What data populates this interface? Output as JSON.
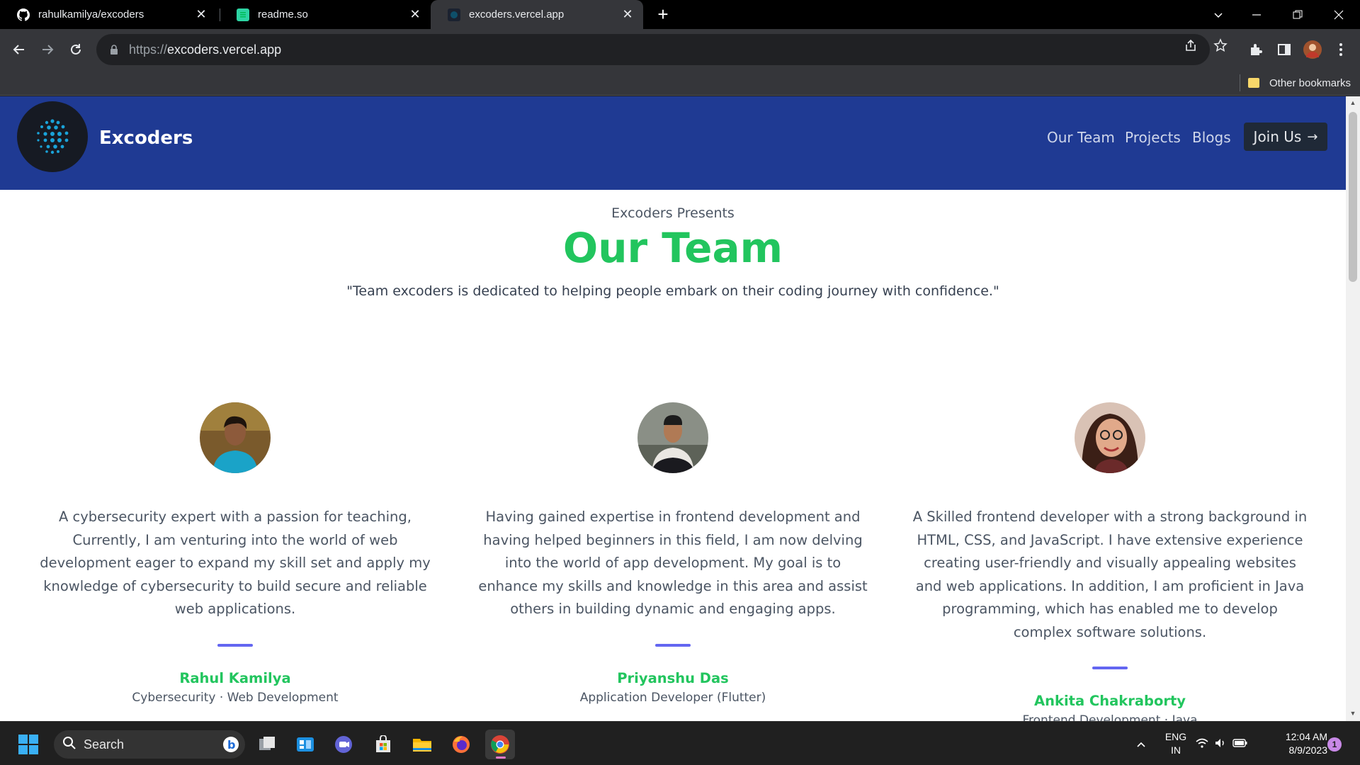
{
  "browser": {
    "tabs": [
      {
        "title": "rahulkamilya/excoders",
        "icon": "github-icon"
      },
      {
        "title": "readme.so",
        "icon": "readme-icon"
      },
      {
        "title": "excoders.vercel.app",
        "icon": "site-icon"
      }
    ],
    "url_scheme": "https://",
    "url_host": "excoders.vercel.app",
    "bookmarks": {
      "other_label": "Other bookmarks"
    }
  },
  "site": {
    "brand": "Excoders",
    "nav": {
      "our_team": "Our Team",
      "projects": "Projects",
      "blogs": "Blogs",
      "join": "Join Us"
    },
    "presents": "Excoders Presents",
    "title": "Our Team",
    "quote": "\"Team excoders is dedicated to helping people embark on their coding journey with confidence.\"",
    "members": [
      {
        "bio": "A cybersecurity expert with a passion for teaching, Currently, I am venturing into the world of web development eager to expand my skill set and apply my knowledge of cybersecurity to build secure and reliable web applications.",
        "name": "Rahul Kamilya",
        "role": "Cybersecurity · Web Development"
      },
      {
        "bio": "Having gained expertise in frontend development and having helped beginners in this field, I am now delving into the world of app development. My goal is to enhance my skills and knowledge in this area and assist others in building dynamic and engaging apps.",
        "name": "Priyanshu Das",
        "role": "Application Developer (Flutter)"
      },
      {
        "bio": "A Skilled frontend developer with a strong background in HTML, CSS, and JavaScript. I have extensive experience creating user-friendly and visually appealing websites and web applications. In addition, I am proficient in Java programming, which has enabled me to develop complex software solutions.",
        "name": "Ankita Chakraborty",
        "role": "Frontend Development · Java"
      }
    ]
  },
  "taskbar": {
    "search_label": "Search",
    "lang_line1": "ENG",
    "lang_line2": "IN",
    "time": "12:04 AM",
    "date": "8/9/2023",
    "notification_count": "1"
  },
  "colors": {
    "nav_bg": "#1f3a93",
    "accent_green": "#22c55e",
    "divider_indigo": "#6366f1"
  }
}
